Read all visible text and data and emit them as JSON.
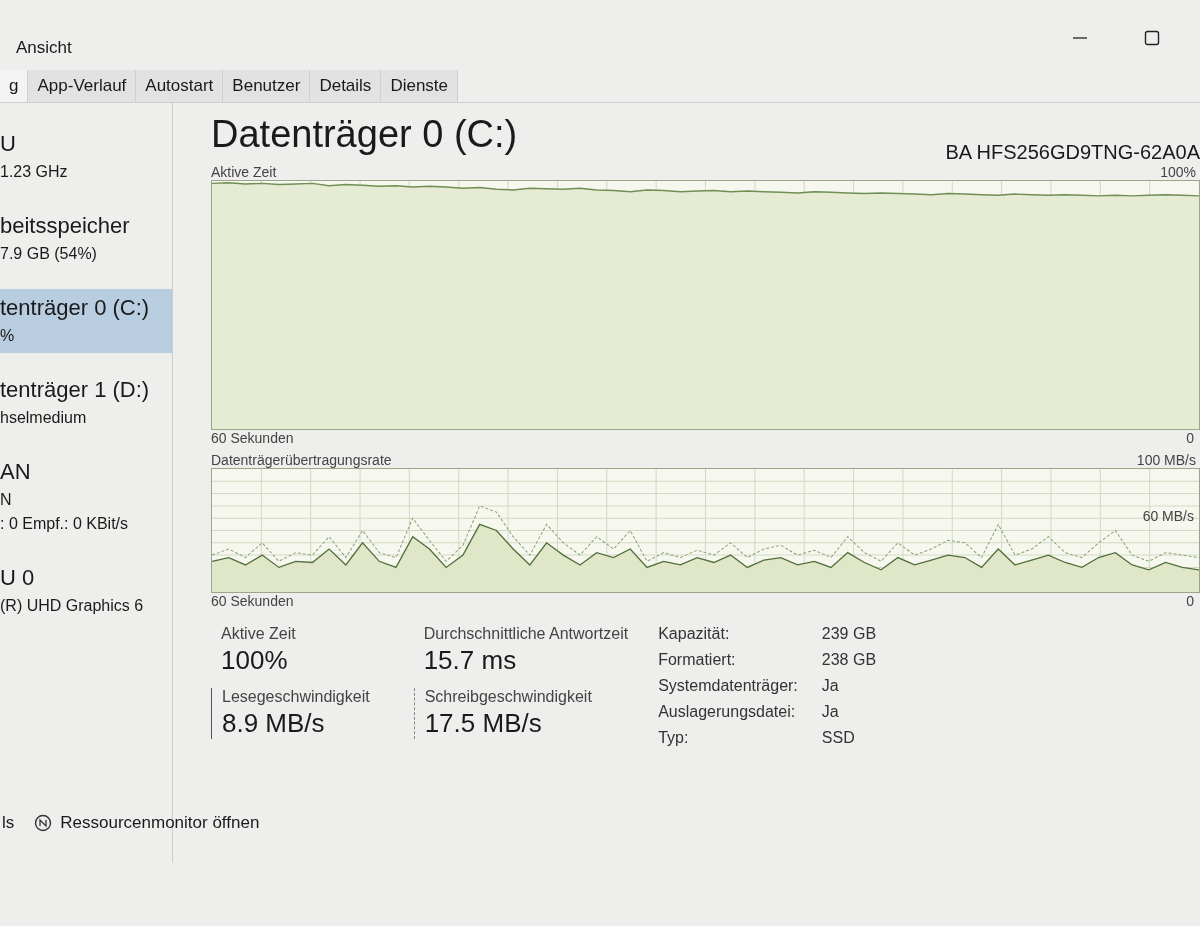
{
  "menu": [
    {
      "label": "Ansicht"
    }
  ],
  "tabs": [
    {
      "label": "g",
      "selected": true
    },
    {
      "label": "App-Verlauf",
      "selected": false
    },
    {
      "label": "Autostart",
      "selected": false
    },
    {
      "label": "Benutzer",
      "selected": false
    },
    {
      "label": "Details",
      "selected": false
    },
    {
      "label": "Dienste",
      "selected": false
    }
  ],
  "sidebar": {
    "items": [
      {
        "lines": [
          "U",
          "1.23 GHz"
        ],
        "selected": false
      },
      {
        "lines": [
          "beitsspeicher",
          "7.9 GB (54%)"
        ],
        "selected": false
      },
      {
        "lines": [
          "tenträger 0 (C:)",
          "%"
        ],
        "selected": true
      },
      {
        "lines": [
          "tenträger 1 (D:)",
          "hselmedium"
        ],
        "selected": false
      },
      {
        "lines": [
          "AN",
          "N",
          ": 0 Empf.: 0 KBit/s"
        ],
        "selected": false
      },
      {
        "lines": [
          "U 0",
          "(R) UHD Graphics 6"
        ],
        "selected": false
      }
    ]
  },
  "main": {
    "title": "Datenträger 0 (C:)",
    "model": "BA HFS256GD9TNG-62A0A",
    "graphs": [
      {
        "label": "Aktive Zeit",
        "max_label": "100%",
        "time_label": "60 Sekunden",
        "min_label": "0",
        "kind": "active"
      },
      {
        "label": "Datenträgerübertragungsrate",
        "max_label": "100 MB/s",
        "mid_label": "60 MB/s",
        "time_label": "60 Sekunden",
        "min_label": "0",
        "kind": "transfer"
      }
    ],
    "stats": [
      {
        "label": "Aktive Zeit",
        "value": "100%",
        "kind": "plain"
      },
      {
        "label": "Durchschnittliche Antwortzeit",
        "value": "15.7 ms",
        "kind": "plain"
      },
      {
        "label": "Lesegeschwindigkeit",
        "value": "8.9 MB/s",
        "kind": "solid"
      },
      {
        "label": "Schreibgeschwindigkeit",
        "value": "17.5 MB/s",
        "kind": "dashed"
      }
    ],
    "properties": [
      {
        "label": "Kapazität:",
        "value": "239 GB"
      },
      {
        "label": "Formatiert:",
        "value": "238 GB"
      },
      {
        "label": "Systemdatenträger:",
        "value": "Ja"
      },
      {
        "label": "Auslagerungsdatei:",
        "value": "Ja"
      },
      {
        "label": "Typ:",
        "value": "SSD"
      }
    ]
  },
  "footer": {
    "left": "ls",
    "link": "Ressourcenmonitor öffnen"
  }
}
